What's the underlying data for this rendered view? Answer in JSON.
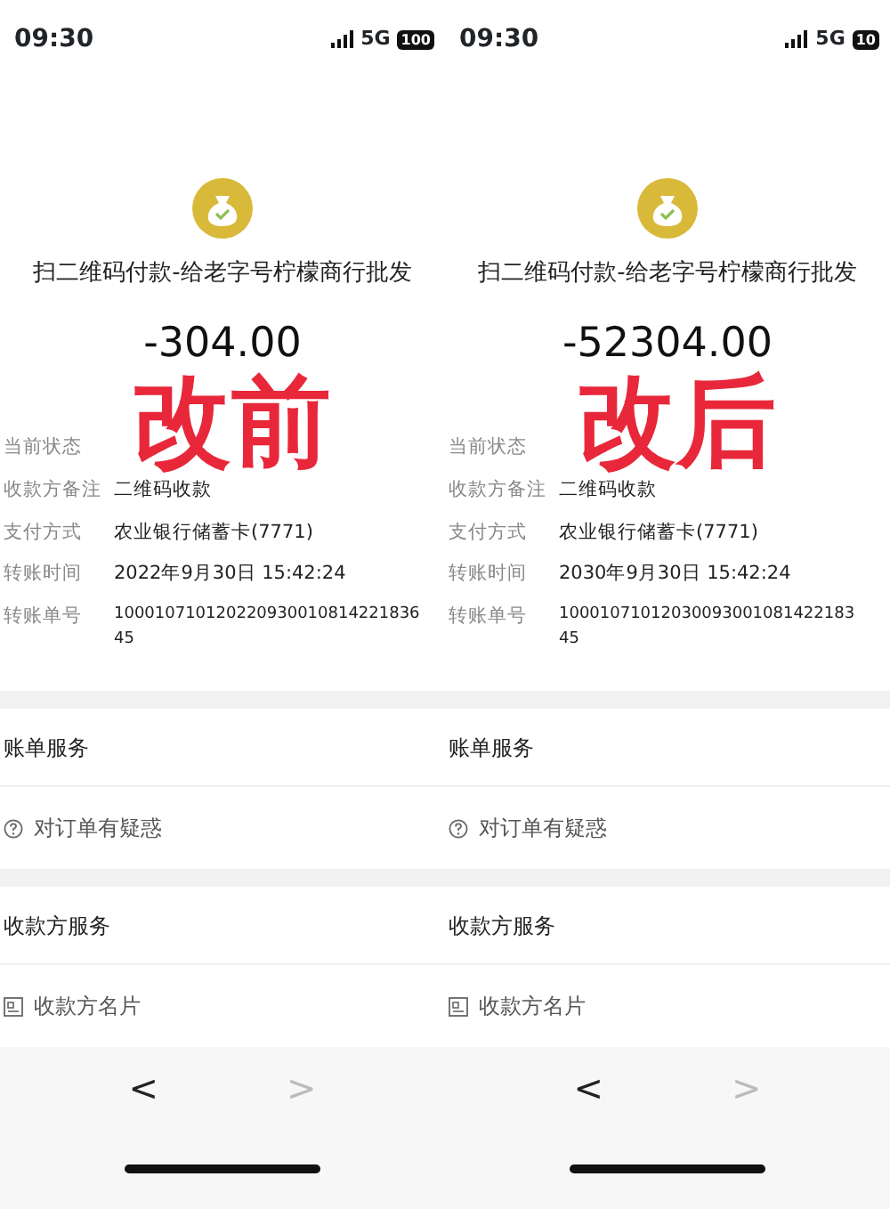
{
  "panels": [
    {
      "status_bar": {
        "time": "09:30",
        "network": "5G",
        "battery": "100"
      },
      "title": "扫二维码付款-给老字号柠檬商行批发",
      "amount": "-304.00",
      "overlay_label": "改前",
      "details": [
        {
          "label": "当前状态"
        },
        {
          "label": "收款方备注",
          "value": "二维码收款"
        },
        {
          "label": "支付方式",
          "value": "农业银行储蓄卡(7771)"
        },
        {
          "label": "转账时间",
          "value": "2022年9月30日 15:42:24"
        },
        {
          "label": "转账单号",
          "value": "100010710120220930010814221836\n45"
        }
      ],
      "sections": [
        {
          "heading": "账单服务",
          "item": {
            "kind": "question",
            "label": "对订单有疑惑"
          }
        },
        {
          "heading": "收款方服务",
          "item": {
            "kind": "card",
            "label": "收款方名片"
          }
        }
      ],
      "nav": {
        "back": "<",
        "forward": ">",
        "forward_disabled": true
      }
    },
    {
      "status_bar": {
        "time": "09:30",
        "network": "5G",
        "battery": "10"
      },
      "title": "扫二维码付款-给老字号柠檬商行批发",
      "amount": "-52304.00",
      "overlay_label": "改后",
      "details": [
        {
          "label": "当前状态"
        },
        {
          "label": "收款方备注",
          "value": "二维码收款"
        },
        {
          "label": "支付方式",
          "value": "农业银行储蓄卡(7771)"
        },
        {
          "label": "转账时间",
          "value": "2030年9月30日 15:42:24"
        },
        {
          "label": "转账单号",
          "value": "10001071012030093001081422183\n45"
        }
      ],
      "sections": [
        {
          "heading": "账单服务",
          "item": {
            "kind": "question",
            "label": "对订单有疑惑"
          }
        },
        {
          "heading": "收款方服务",
          "item": {
            "kind": "card",
            "label": "收款方名片"
          }
        }
      ],
      "nav": {
        "back": "<",
        "forward": ">",
        "forward_disabled": true
      }
    }
  ]
}
